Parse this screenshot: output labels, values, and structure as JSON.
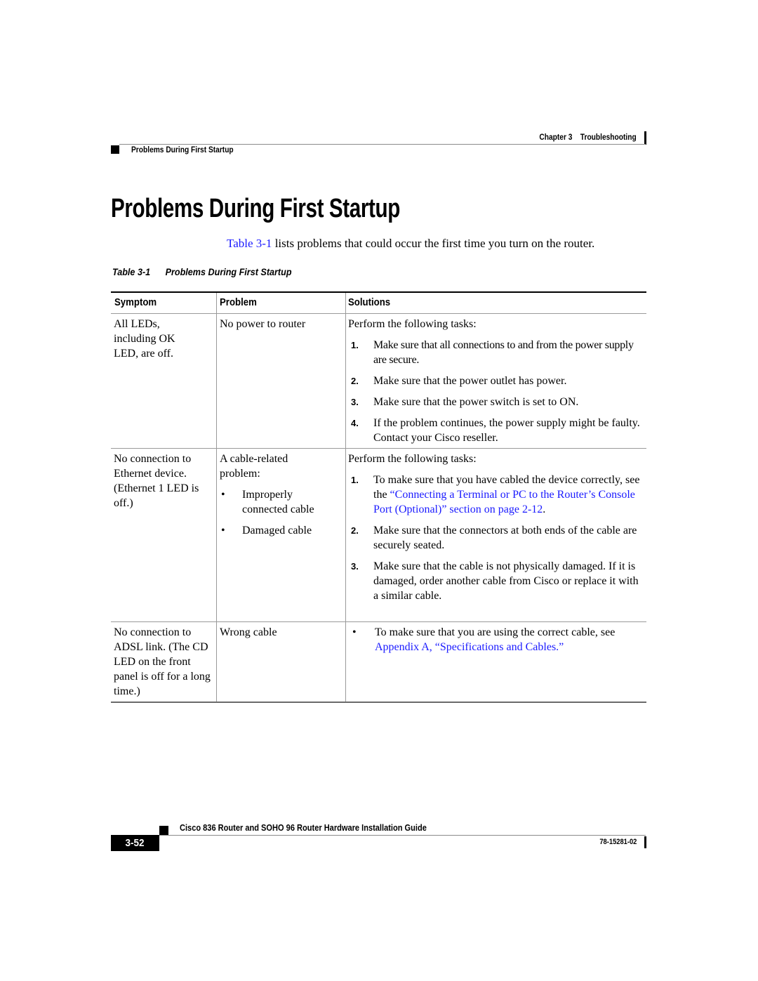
{
  "header": {
    "chapter": "Chapter 3",
    "chapter_title": "Troubleshooting",
    "section": "Problems During First Startup"
  },
  "page_title": "Problems During First Startup",
  "intro": {
    "link_text": "Table 3-1",
    "text": " lists problems that could occur the first time you turn on the router."
  },
  "table": {
    "caption_number": "Table 3-1",
    "caption_title": "Problems During First Startup",
    "columns": [
      "Symptom",
      "Problem",
      "Solutions"
    ],
    "rows": [
      {
        "symptom": "All LEDs, including OK LED, are off.",
        "problem": "No power to router",
        "solution_intro": "Perform the following tasks:",
        "steps": [
          {
            "num": "1.",
            "text": "Make sure that all connections to and from the power supply are secure."
          },
          {
            "num": "2.",
            "text": "Make sure that the power outlet has power."
          },
          {
            "num": "3.",
            "text": "Make sure that the power switch is set to ON."
          },
          {
            "num": "4.",
            "text": "If the problem continues, the power supply might be faulty. Contact your Cisco reseller."
          }
        ]
      },
      {
        "symptom": "No connection to Ethernet device. (Ethernet 1 LED is off.)",
        "problem_intro": "A cable-related problem:",
        "problem_bullets": [
          "Improperly connected cable",
          "Damaged cable"
        ],
        "solution_intro": "Perform the following tasks:",
        "steps": [
          {
            "num": "1.",
            "text_before": "To make sure that you have cabled the device correctly, see the ",
            "link": "“Connecting a Terminal or PC to the Router’s Console Port (Optional)” section on page 2-12",
            "text_after": "."
          },
          {
            "num": "2.",
            "text": "Make sure that the connectors at both ends of the cable are securely seated."
          },
          {
            "num": "3.",
            "text": "Make sure that the cable is not physically damaged. If it is damaged, order another cable from Cisco or replace it with a similar cable."
          }
        ]
      },
      {
        "symptom": "No connection to ADSL link. (The CD LED on the front panel is off for a long time.)",
        "problem": "Wrong cable",
        "solution_bullet": {
          "text_before": "To make sure that you are using the correct cable, see ",
          "link": "Appendix A, “Specifications and Cables.”"
        }
      }
    ]
  },
  "footer": {
    "guide_title": "Cisco 836 Router and SOHO 96 Router Hardware Installation Guide",
    "page_number": "3-52",
    "doc_number": "78-15281-02"
  },
  "colors": {
    "link": "#1a1aff",
    "rule": "#9a9a9a"
  }
}
